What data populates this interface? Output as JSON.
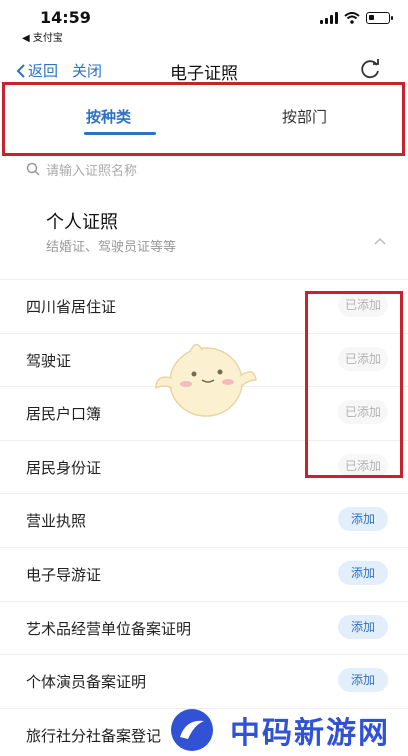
{
  "status": {
    "time": "14:59",
    "back_app": "◀ 支付宝"
  },
  "nav": {
    "back_label": "返回",
    "close_label": "关闭",
    "title": "电子证照"
  },
  "tabs": [
    {
      "label": "按种类",
      "active": true
    },
    {
      "label": "按部门",
      "active": false
    }
  ],
  "search": {
    "placeholder": "请输入证照名称"
  },
  "section": {
    "title": "个人证照",
    "subtitle": "结婚证、驾驶员证等等"
  },
  "items": [
    {
      "label": "四川省居住证",
      "status": "已添加"
    },
    {
      "label": "驾驶证",
      "status": "已添加"
    },
    {
      "label": "居民户口簿",
      "status": "已添加"
    },
    {
      "label": "居民身份证",
      "status": "已添加"
    },
    {
      "label": "营业执照",
      "status": "添加"
    },
    {
      "label": "电子导游证",
      "status": "添加"
    },
    {
      "label": "艺术品经营单位备案证明",
      "status": "添加"
    },
    {
      "label": "个体演员备案证明",
      "status": "添加"
    },
    {
      "label": "旅行社分社备案登记",
      "status": ""
    }
  ],
  "watermark": {
    "text": "中码新游网"
  },
  "colors": {
    "accent": "#2c72c7",
    "highlight_box": "#c8232c",
    "watermark": "#3152d4"
  }
}
